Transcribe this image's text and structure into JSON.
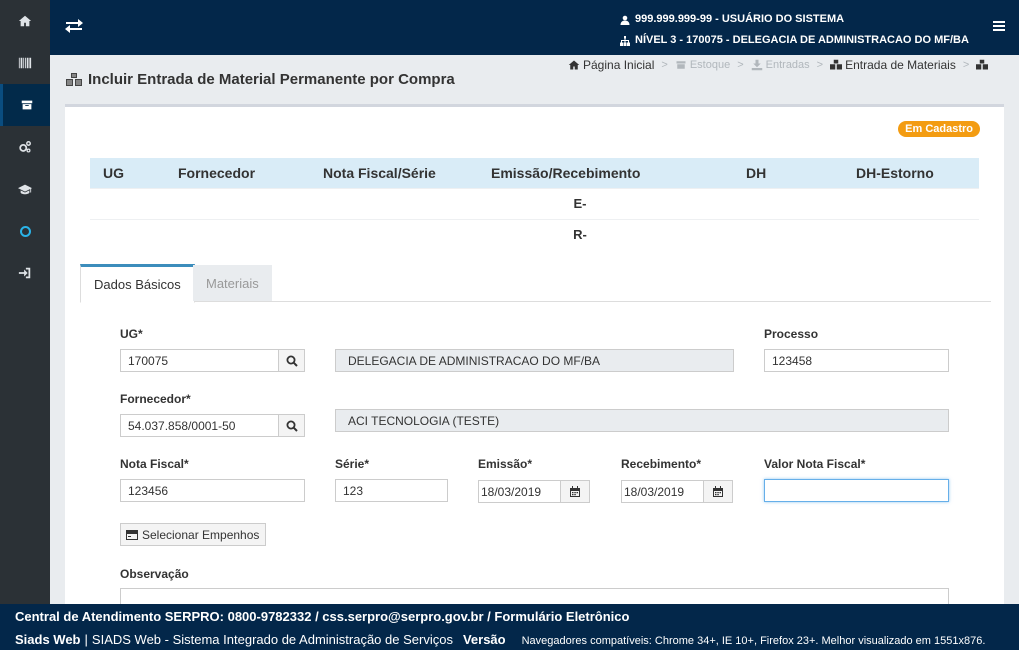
{
  "sidebar": {
    "items": [
      {
        "icon": "home-icon"
      },
      {
        "icon": "barcode-icon"
      },
      {
        "icon": "archive-icon"
      },
      {
        "icon": "cogs-icon"
      },
      {
        "icon": "graduation-cap-icon"
      },
      {
        "icon": "circle-icon"
      },
      {
        "icon": "sign-in-icon"
      }
    ],
    "active_index": 2
  },
  "topbar": {
    "user": "999.999.999-99 - USUÁRIO DO SISTEMA",
    "level": "NÍVEL 3 - 170075 - DELEGACIA DE ADMINISTRACAO DO MF/BA"
  },
  "page": {
    "title": "Incluir Entrada de Material Permanente por Compra"
  },
  "breadcrumb": {
    "home": "Página Inicial",
    "stock": "Estoque",
    "entries": "Entradas",
    "current": "Entrada de Materiais",
    "separator": ">"
  },
  "status_badge": "Em Cadastro",
  "summary": {
    "headers": [
      "UG",
      "Fornecedor",
      "Nota Fiscal/Série",
      "Emissão/Recebimento",
      "DH",
      "DH-Estorno"
    ],
    "rows": [
      {
        "emissao_recebimento": "E-"
      },
      {
        "emissao_recebimento": "R-"
      }
    ]
  },
  "tabs": [
    {
      "label": "Dados Básicos",
      "active": true
    },
    {
      "label": "Materiais",
      "active": false
    }
  ],
  "form": {
    "ug": {
      "label": "UG*",
      "value": "170075"
    },
    "ug_name": "DELEGACIA DE ADMINISTRACAO DO MF/BA",
    "processo": {
      "label": "Processo",
      "value": "123458"
    },
    "fornecedor": {
      "label": "Fornecedor*",
      "value": "54.037.858/0001-50"
    },
    "fornecedor_name": "ACI TECNOLOGIA (TESTE)",
    "nota_fiscal": {
      "label": "Nota Fiscal*",
      "value": "123456"
    },
    "serie": {
      "label": "Série*",
      "value": "123"
    },
    "emissao": {
      "label": "Emissão*",
      "value": "18/03/2019"
    },
    "recebimento": {
      "label": "Recebimento*",
      "value": "18/03/2019"
    },
    "valor_nota": {
      "label": "Valor Nota Fiscal*",
      "value": ""
    },
    "select_empenhos": "Selecionar Empenhos",
    "observacao": {
      "label": "Observação"
    }
  },
  "footer": {
    "contact": "Central de Atendimento SERPRO: 0800-9782332 / css.serpro@serpro.gov.br / Formulário Eletrônico",
    "app_name": "Siads Web",
    "separator": "|",
    "app_full": "SIADS Web - Sistema Integrado de Administração de Serviços",
    "version_label": "Versão",
    "browsers": "Navegadores compatíveis: Chrome 34+, IE 10+, Firefox 23+. Melhor visualizado em 1551x876."
  },
  "colors": {
    "navy": "#03274a",
    "sidebar": "#2b3136",
    "badge": "#f39c12",
    "table_header": "#d9ecf7",
    "tab_accent": "#3c8dbc"
  }
}
